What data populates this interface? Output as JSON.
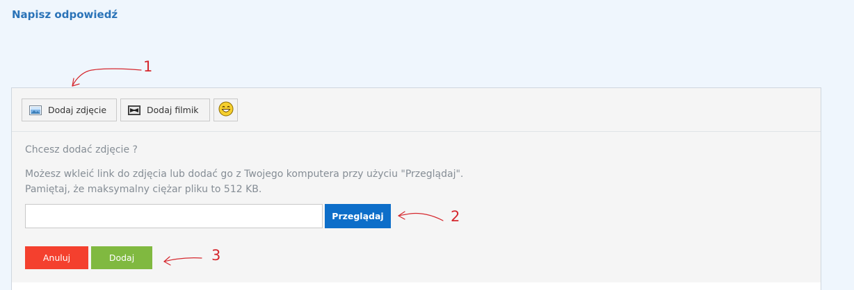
{
  "header": {
    "title": "Napisz odpowiedź"
  },
  "toolbar": {
    "add_photo_label": "Dodaj zdjęcie",
    "add_video_label": "Dodaj filmik"
  },
  "photo_panel": {
    "question": "Chcesz dodać zdjęcie ?",
    "description_line1": "Możesz wkleić link do zdjęcia lub dodać go z Twojego komputera przy użyciu \"Przeglądaj\".",
    "description_line2": "Pamiętaj, że maksymalny ciężar pliku to 512 KB.",
    "url_value": "",
    "browse_label": "Przeglądaj",
    "cancel_label": "Anuluj",
    "add_label": "Dodaj"
  },
  "annotations": {
    "marker1": "1",
    "marker2": "2",
    "marker3": "3"
  },
  "colors": {
    "page_bg": "#eff6fd",
    "title": "#2a73b8",
    "browse": "#0d6ec9",
    "cancel": "#f4402e",
    "add": "#80b940",
    "annotation": "#d5272d"
  }
}
